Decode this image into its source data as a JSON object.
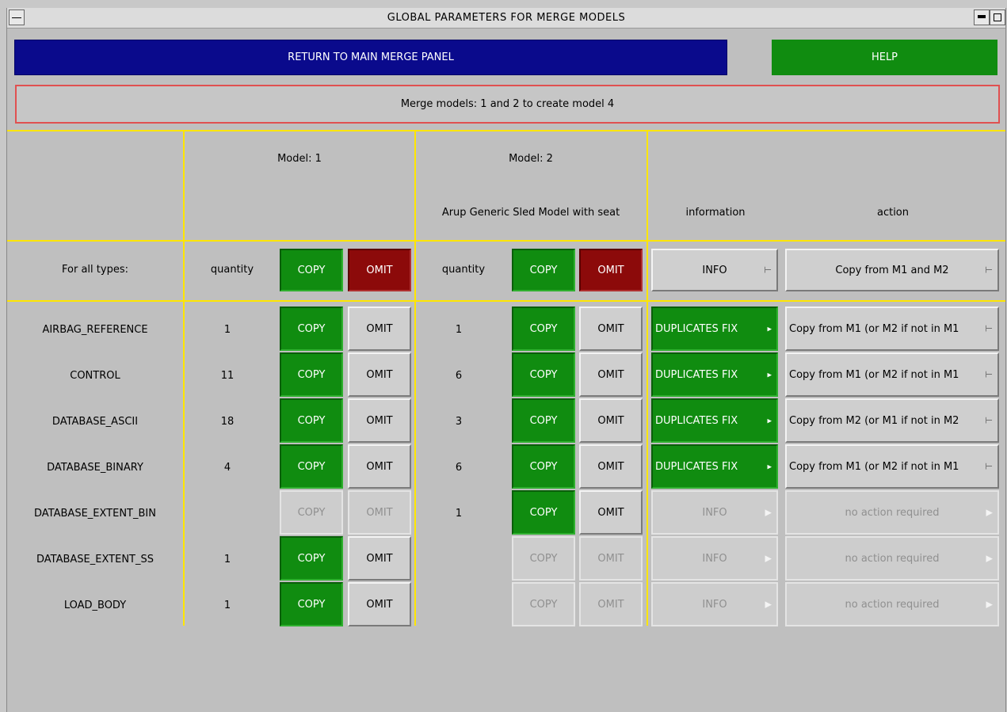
{
  "window": {
    "title": "GLOBAL PARAMETERS FOR MERGE MODELS"
  },
  "toolbar": {
    "return_label": "RETURN TO MAIN MERGE PANEL",
    "help_label": "HELP"
  },
  "message": "Merge models: 1 and 2 to create model 4",
  "header": {
    "model1_title": "Model: 1",
    "model2_title": "Model: 2",
    "model2_name": "Arup Generic Sled Model with seat",
    "information_label": "information",
    "action_label": "action"
  },
  "all_types": {
    "label": "For all types:",
    "m1_quantity_label": "quantity",
    "m2_quantity_label": "quantity",
    "copy_label": "COPY",
    "omit_label": "OMIT",
    "info_label": "INFO",
    "action_label": "Copy from M1 and M2"
  },
  "rows": [
    {
      "name": "AIRBAG_REFERENCE",
      "m1_qty": "1",
      "m1_copy": "COPY",
      "m1_omit": "OMIT",
      "m2_qty": "1",
      "m2_copy": "COPY",
      "m2_omit": "OMIT",
      "info": "DUPLICATES FIX",
      "action": "Copy from M1 (or M2 if not in M1"
    },
    {
      "name": "CONTROL",
      "m1_qty": "11",
      "m1_copy": "COPY",
      "m1_omit": "OMIT",
      "m2_qty": "6",
      "m2_copy": "COPY",
      "m2_omit": "OMIT",
      "info": "DUPLICATES FIX",
      "action": "Copy from M1 (or M2 if not in M1"
    },
    {
      "name": "DATABASE_ASCII",
      "m1_qty": "18",
      "m1_copy": "COPY",
      "m1_omit": "OMIT",
      "m2_qty": "3",
      "m2_copy": "COPY",
      "m2_omit": "OMIT",
      "info": "DUPLICATES FIX",
      "action": "Copy from M2 (or M1 if not in M2"
    },
    {
      "name": "DATABASE_BINARY",
      "m1_qty": "4",
      "m1_copy": "COPY",
      "m1_omit": "OMIT",
      "m2_qty": "6",
      "m2_copy": "COPY",
      "m2_omit": "OMIT",
      "info": "DUPLICATES FIX",
      "action": "Copy from M1 (or M2 if not in M1"
    },
    {
      "name": "DATABASE_EXTENT_BIN",
      "m1_qty": "",
      "m1_copy": "COPY",
      "m1_omit": "OMIT",
      "m2_qty": "1",
      "m2_copy": "COPY",
      "m2_omit": "OMIT",
      "info": "INFO",
      "action": "no action required"
    },
    {
      "name": "DATABASE_EXTENT_SS",
      "m1_qty": "1",
      "m1_copy": "COPY",
      "m1_omit": "OMIT",
      "m2_qty": "",
      "m2_copy": "COPY",
      "m2_omit": "OMIT",
      "info": "INFO",
      "action": "no action required"
    },
    {
      "name": "LOAD_BODY",
      "m1_qty": "1",
      "m1_copy": "COPY",
      "m1_omit": "OMIT",
      "m2_qty": "",
      "m2_copy": "COPY",
      "m2_omit": "OMIT",
      "info": "INFO",
      "action": "no action required"
    }
  ]
}
